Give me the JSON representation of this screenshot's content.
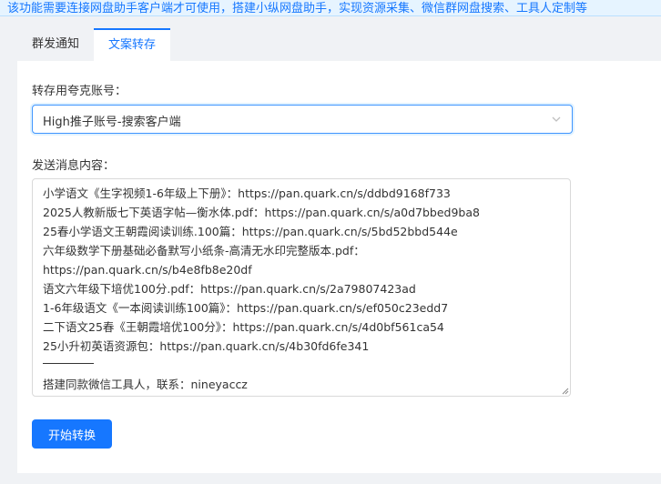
{
  "notice": {
    "text": "该功能需要连接网盘助手客户端才可使用，搭建小纵网盘助手，实现资源采集、微信群网盘搜索、工具人定制等"
  },
  "tabs": [
    {
      "label": "群发通知"
    },
    {
      "label": "文案转存"
    }
  ],
  "form": {
    "account_label": "转存用夸克账号：",
    "account_value": "High推子账号-搜索客户端",
    "message_label": "发送消息内容：",
    "message_lines": [
      "小学语文《生字视频1-6年级上下册》：https://pan.quark.cn/s/ddbd9168f733",
      "2025人教新版七下英语字帖—衡水体.pdf：https://pan.quark.cn/s/a0d7bbed9ba8",
      "25春小学语文王朝霞阅读训练.100篇：https://pan.quark.cn/s/5bd52bbd544e",
      "六年级数学下册基础必备默写小纸条-高清无水印完整版本.pdf：",
      "https://pan.quark.cn/s/b4e8fb8e20df",
      "语文六年级下培优100分.pdf：https://pan.quark.cn/s/2a79807423ad",
      "1-6年级语文《一本阅读训练100篇》：https://pan.quark.cn/s/ef050c23edd7",
      "二下语文25春《王朝霞培优100分》：https://pan.quark.cn/s/4d0bf561ca54",
      "25小升初英语资源包：https://pan.quark.cn/s/4b30fd6fe341",
      "搭建同款微信工具人，联系：nineyaccz"
    ],
    "submit_label": "开始转换"
  },
  "icons": {
    "select_arrow": "chevron-down-icon",
    "resize": "resize-handle-icon"
  },
  "colors": {
    "accent": "#1677ff",
    "background": "#f0f2f5",
    "panel": "#ffffff",
    "notice_bg": "#e6f4ff"
  }
}
